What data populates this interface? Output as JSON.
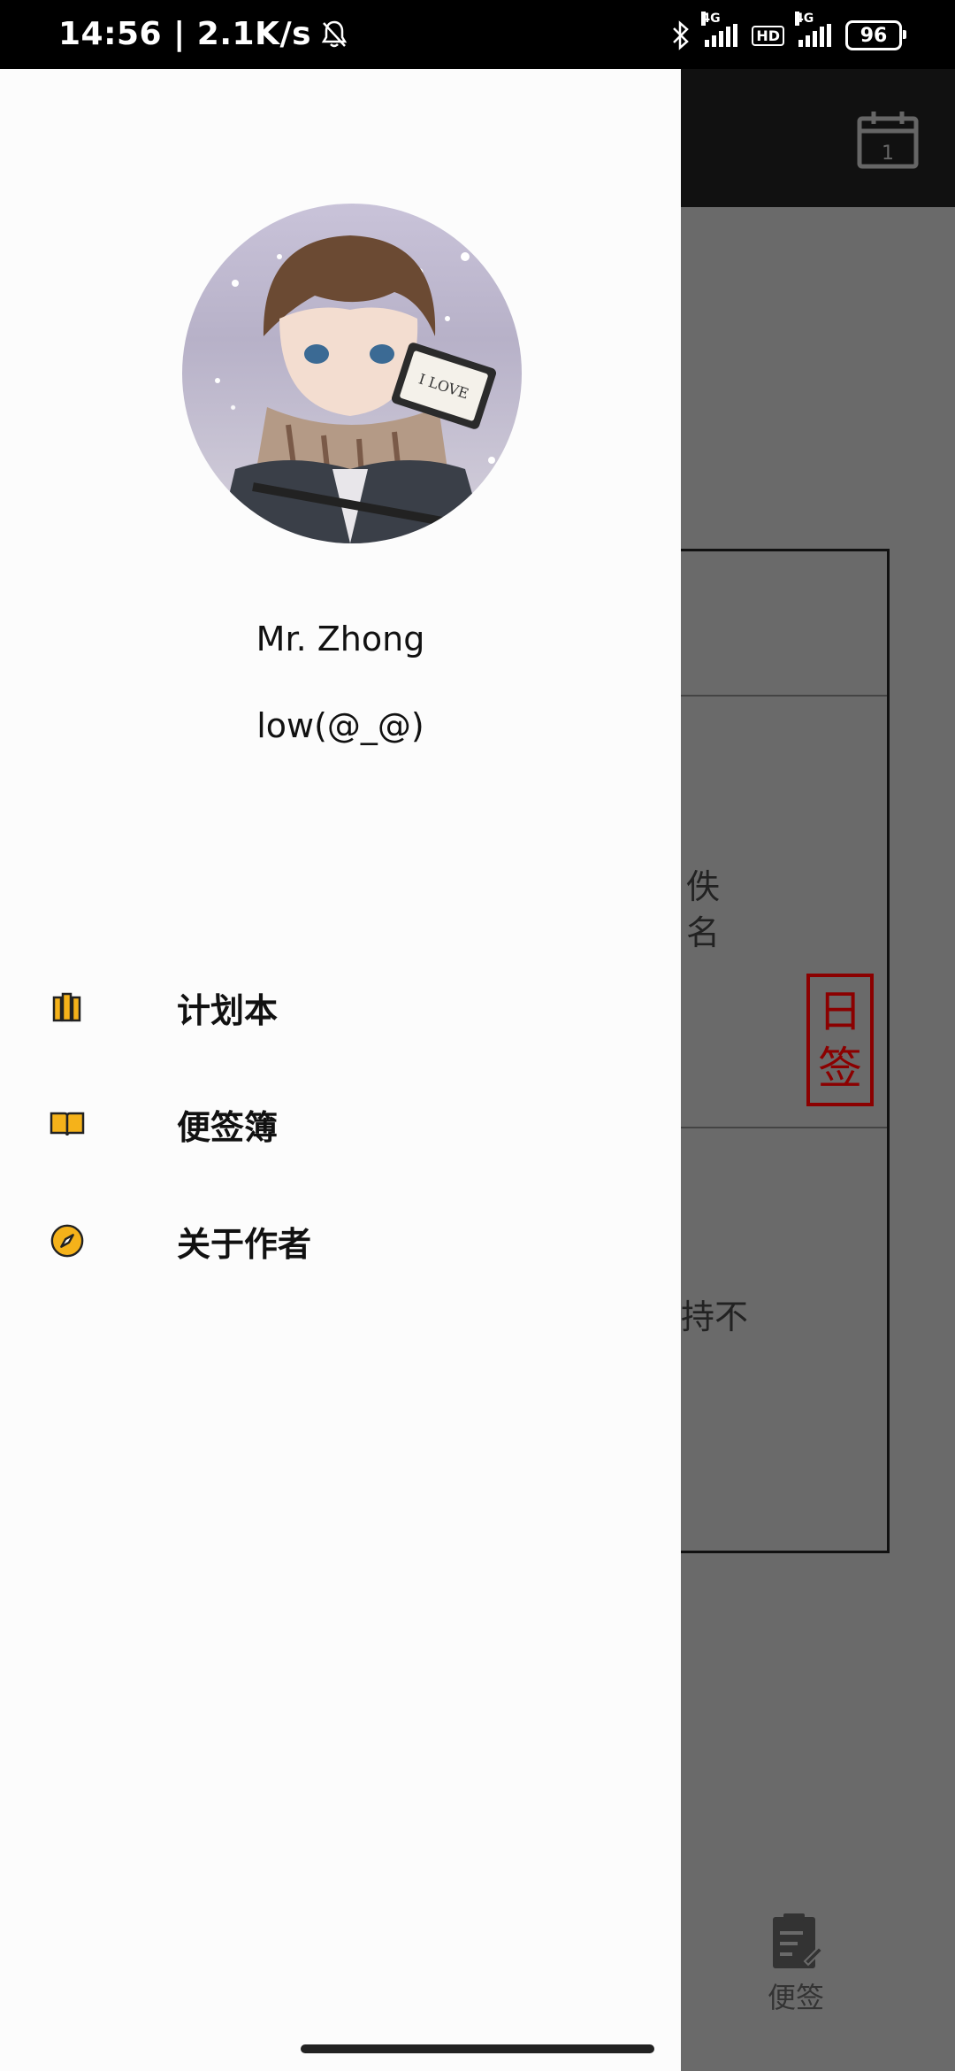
{
  "status_bar": {
    "time_speed": "14:56 | 2.1K/s",
    "network_tag_1": "4G",
    "hd": "HD",
    "network_tag_2": "4G",
    "battery": "96"
  },
  "background_app": {
    "note_text_1": "佚",
    "note_text_2": "名",
    "stamp_line1": "日",
    "stamp_line2": "签",
    "note_text_3": "持不",
    "bottom_tab_label": "便签"
  },
  "drawer": {
    "user_name": "Mr. Zhong",
    "bio": "low(@_@)",
    "menu": [
      {
        "label": "计划本",
        "icon": "books-icon"
      },
      {
        "label": "便签簿",
        "icon": "open-book-icon"
      },
      {
        "label": "关于作者",
        "icon": "compass-icon"
      }
    ]
  },
  "colors": {
    "accent": "#F5B21A",
    "stamp_red": "#8B0000",
    "drawer_bg": "#FCFCFC"
  }
}
